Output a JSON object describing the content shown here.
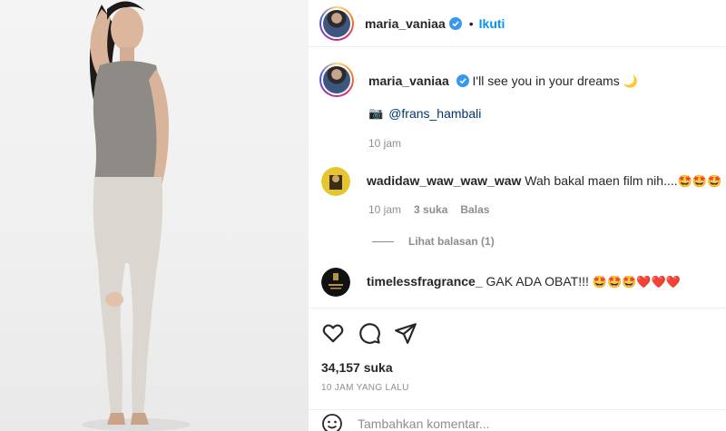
{
  "post": {
    "username": "maria_vaniaa",
    "separator": "•",
    "follow_label": "Ikuti",
    "caption_text": "I'll see you in your dreams",
    "caption_emoji": "🌙",
    "credit_emoji": "📷",
    "credit_mention": "@frans_hambali",
    "caption_time": "10 jam"
  },
  "comments": [
    {
      "username": "wadidaw_waw_waw_waw",
      "text": "Wah bakal maen film nih....",
      "emojis": "🤩🤩🤩",
      "time": "10 jam",
      "likes": "3 suka",
      "reply": "Balas",
      "view_replies": "Lihat balasan (1)"
    },
    {
      "username": "timelessfragrance_",
      "text": "GAK ADA OBAT!!!",
      "emojis": "🤩🤩🤩❤️❤️❤️"
    }
  ],
  "actions": {
    "likes_count": "34,157 suka",
    "posted_ago": "10 JAM YANG LALU",
    "comment_placeholder": "Tambahkan komentar..."
  },
  "icons": [
    "heart-icon",
    "comment-icon",
    "share-icon",
    "verified-icon",
    "emoji-icon"
  ],
  "colors": {
    "follow": "#0095f6",
    "mention": "#00376b",
    "muted": "#8e8e8e",
    "verified": "#3897f0"
  }
}
